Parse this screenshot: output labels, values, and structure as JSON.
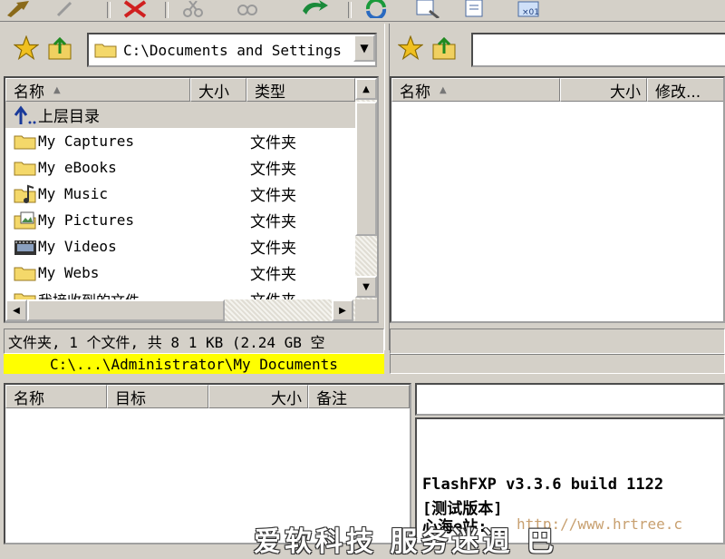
{
  "left_panel": {
    "path": "C:\\Documents and Settings",
    "columns": {
      "name": "名称",
      "size": "大小",
      "type": "类型"
    },
    "items": [
      {
        "name": "上层目录",
        "type": "",
        "icon": "up-folder-icon"
      },
      {
        "name": "My Captures",
        "type": "文件夹",
        "icon": "folder-icon"
      },
      {
        "name": "My eBooks",
        "type": "文件夹",
        "icon": "folder-icon"
      },
      {
        "name": "My Music",
        "type": "文件夹",
        "icon": "music-folder-icon"
      },
      {
        "name": "My Pictures",
        "type": "文件夹",
        "icon": "pictures-folder-icon"
      },
      {
        "name": "My Videos",
        "type": "文件夹",
        "icon": "video-folder-icon"
      },
      {
        "name": "My Webs",
        "type": "文件夹",
        "icon": "folder-icon"
      },
      {
        "name": "我接收到的文件",
        "type": "文件夹",
        "icon": "folder-icon"
      }
    ],
    "status": "文件夹, 1 个文件, 共 8 1 KB (2.24 GB 空",
    "current_path": "C:\\...\\Administrator\\My Documents"
  },
  "right_panel": {
    "path": "",
    "columns": {
      "name": "名称",
      "size": "大小",
      "modified": "修改..."
    }
  },
  "queue": {
    "columns": {
      "name": "名称",
      "target": "目标",
      "size": "大小",
      "note": "备注"
    }
  },
  "log": {
    "lines": [
      "FlashFXP v3.3.6 build 1122",
      "[测试版本]",
      "心海e站:"
    ],
    "url": "http://www.hrtree.c"
  },
  "watermark": {
    "text": "爱软科技  服务迷週 巴"
  },
  "colors": {
    "path_highlight": "#ffff00",
    "chrome": "#d4d0c8",
    "url_color": "#c8a070"
  }
}
